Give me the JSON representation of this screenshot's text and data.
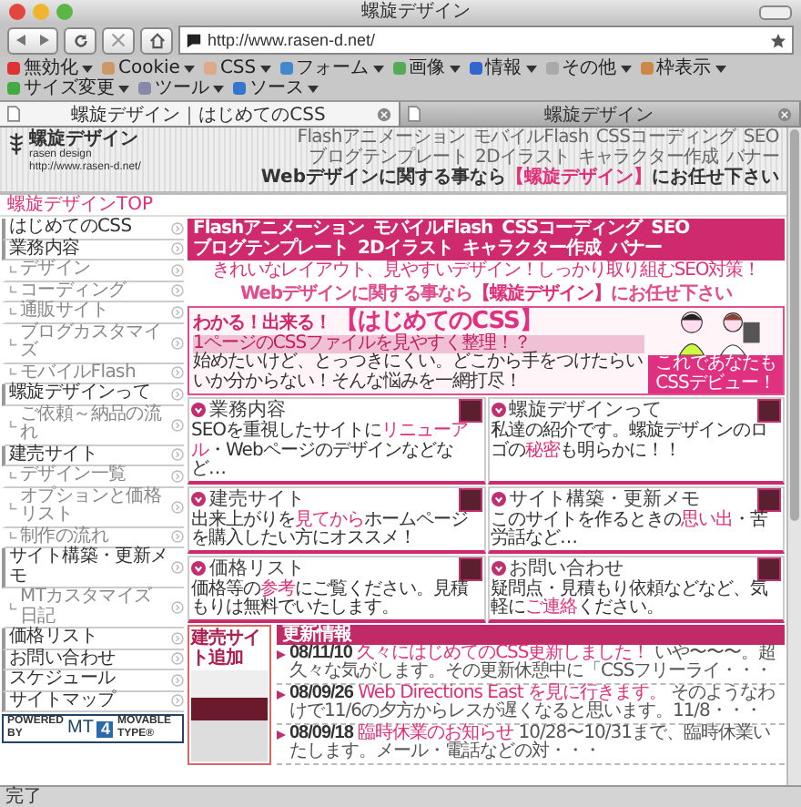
{
  "window": {
    "title": "螺旋デザイン"
  },
  "toolbar": {
    "url": "http://www.rasen-d.net/"
  },
  "bookmarks": [
    {
      "label": "無効化"
    },
    {
      "label": "Cookie"
    },
    {
      "label": "CSS"
    },
    {
      "label": "フォーム"
    },
    {
      "label": "画像"
    },
    {
      "label": "情報"
    },
    {
      "label": "その他"
    },
    {
      "label": "枠表示"
    },
    {
      "label": "サイズ変更"
    },
    {
      "label": "ツール"
    },
    {
      "label": "ソース"
    }
  ],
  "tabs": [
    {
      "label": "螺旋デザイン｜はじめてのCSS",
      "selected": false
    },
    {
      "label": "螺旋デザイン",
      "selected": true
    }
  ],
  "header": {
    "site_name": "螺旋デザイン",
    "site_name_en": "rasen design",
    "site_url": "http://www.rasen-d.net/",
    "nav": [
      "Flashアニメーション",
      "モバイルFlash",
      "CSSコーディング",
      "SEO",
      "ブログテンプレート",
      "2Dイラスト",
      "キャラクター作成",
      "バナー"
    ],
    "tagline": "Webデザインに関する事なら**【螺旋デザイン】**にお任せ下さい"
  },
  "breadcrumb": "螺旋デザインTOP",
  "sidebar": {
    "items": [
      {
        "label": "はじめてのCSS"
      },
      {
        "label": "業務内容",
        "children": [
          {
            "label": "デザイン"
          },
          {
            "label": "コーディング"
          },
          {
            "label": "通販サイト"
          },
          {
            "label": "ブログカスタマイズ"
          },
          {
            "label": "モバイルFlash"
          }
        ]
      },
      {
        "label": "螺旋デザインって",
        "children": [
          {
            "label": "ご依頼～納品の流れ"
          }
        ]
      },
      {
        "label": "建売サイト",
        "children": [
          {
            "label": "デザイン一覧"
          },
          {
            "label": "オプションと価格リスト"
          },
          {
            "label": "制作の流れ"
          }
        ]
      },
      {
        "label": "サイト構築・更新メモ",
        "children": [
          {
            "label": "MTカスタマイズ日記"
          }
        ]
      },
      {
        "label": "価格リスト"
      },
      {
        "label": "お問い合わせ"
      },
      {
        "label": "スケジュール"
      },
      {
        "label": "サイトマップ"
      }
    ]
  },
  "mt_badge": {
    "powered": "POWERED BY",
    "logo": "MT",
    "version": "4",
    "product": "MOVABLE TYPE®"
  },
  "content": {
    "nav": [
      "Flashアニメーション",
      "モバイルFlash",
      "CSSコーディング",
      "SEO",
      "ブログテンプレート",
      "2Dイラスト",
      "キャラクター作成",
      "バナー"
    ],
    "catch": "きれいなレイアウト、見やすいデザイン！しっかり取り組むSEO対策！",
    "headline": "Webデザインに関する事なら**【螺旋デザイン】**にお任せ下さい",
    "banner": {
      "kicker": "わかる！出来る！",
      "title": "【はじめてのCSS】",
      "subtitle": "1ページのCSSファイルを見やすく整理！？",
      "callout": "これであなたもCSSデビュー！",
      "description": "始めたいけど、とっつきにくい。どこから手をつけたらいいか分からない！そんな悩みを一網打尽！"
    },
    "tiles": [
      {
        "title": "業務内容",
        "text": "SEOを重視したサイトに**リニューアル**・Webページのデザインなどなど…"
      },
      {
        "title": "螺旋デザインって",
        "text": "私達の紹介です。螺旋デザインのロゴの**秘密**も明らかに！！"
      },
      {
        "title": "建売サイト",
        "text": "出来上がりを**見てから**ホームページを購入したい方にオススメ！"
      },
      {
        "title": "サイト構築・更新メモ",
        "text": "このサイトを作るときの**思い出**・苦労話など…"
      },
      {
        "title": "価格リスト",
        "text": "価格等の**参考**にご覧ください。見積もりは無料でいたします。"
      },
      {
        "title": "お問い合わせ",
        "text": "疑問点・見積もり依頼などなど、気軽に**ご連絡**ください。"
      }
    ],
    "new_site": {
      "title": "建売サイト追加"
    },
    "news": {
      "title": "更新情報",
      "entries": [
        {
          "date": "08/11/10",
          "title": "久々にはじめてのCSS更新しました！",
          "text": "いや〜〜〜。超久々な気がします。その更新休憩中に「CSSフリーライ・・・"
        },
        {
          "date": "08/09/26",
          "title": "Web Directions East を見に行きます。",
          "text": "そのようなわけで11/6の夕方からレスが遅くなると思います。11/8・・・"
        },
        {
          "date": "08/09/18",
          "title": "臨時休業のお知らせ",
          "text": "10/28〜10/31まで、臨時休業いたします。メール・電話などの対・・・"
        }
      ]
    }
  },
  "status_bar": "完了"
}
